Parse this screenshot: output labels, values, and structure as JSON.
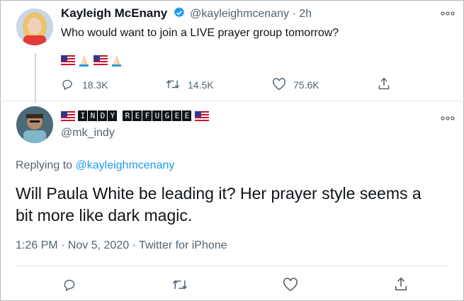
{
  "tweet": {
    "author_name": "Kayleigh McEnany",
    "handle": "@kayleighmcenany",
    "separator": "·",
    "time": "2h",
    "text": "Who would want to join a LIVE prayer group tomorrow?",
    "replies": "18.3K",
    "retweets": "14.5K",
    "likes": "75.6K"
  },
  "reply": {
    "display_name_letters": [
      "I",
      "N",
      "D",
      "Y",
      " ",
      "R",
      "E",
      "F",
      "U",
      "G",
      "E",
      "E"
    ],
    "handle": "@mk_indy",
    "replying_to_prefix": "Replying to ",
    "replying_to_handle": "@kayleighmcenany",
    "text": "Will Paula White be leading it? Her prayer style seems a bit more like dark magic.",
    "time": "1:26 PM",
    "sep1": "·",
    "date": "Nov 5, 2020",
    "sep2": "·",
    "source": "Twitter for iPhone"
  },
  "colors": {
    "accent": "#1d9bf0",
    "muted": "#536471",
    "text": "#0f1419"
  },
  "icons": [
    "verified-badge-icon",
    "more-options-icon",
    "reply-icon",
    "retweet-icon",
    "like-icon",
    "share-icon",
    "us-flag-icon",
    "folded-hands-icon"
  ]
}
